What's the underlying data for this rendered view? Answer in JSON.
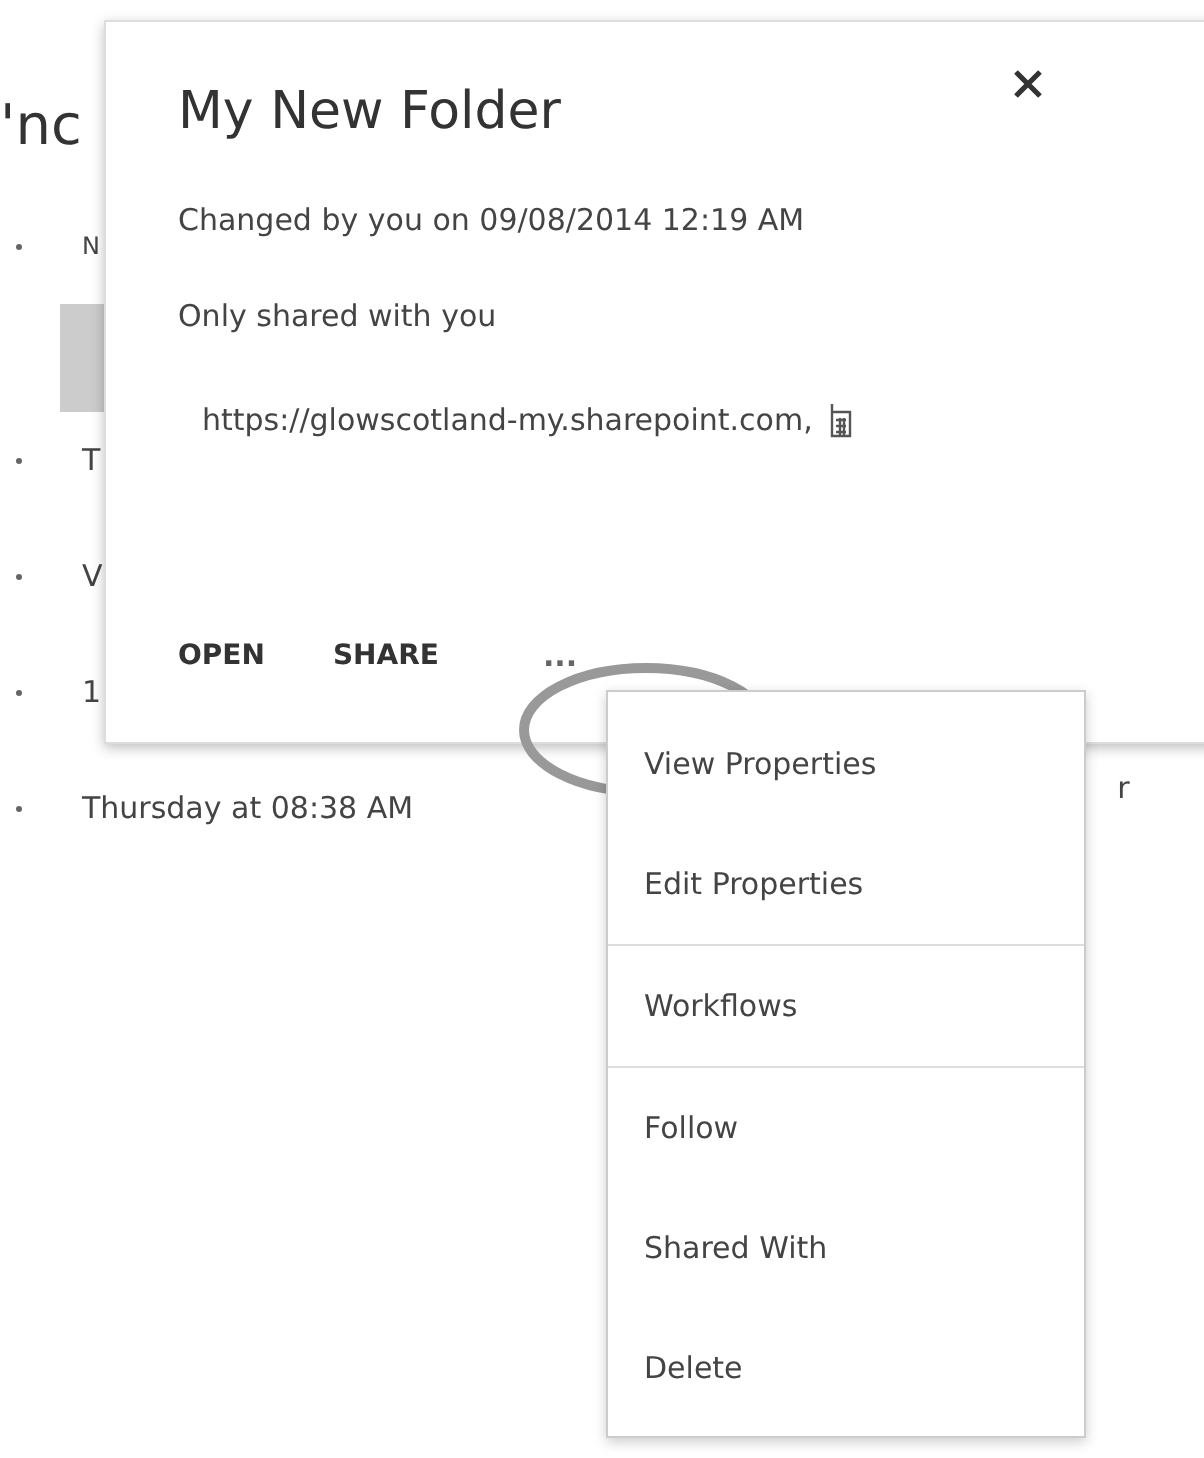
{
  "background": {
    "heading_fragment": "'nc",
    "rows": [
      {
        "text": "N"
      },
      {
        "text": "T"
      },
      {
        "text": "V"
      },
      {
        "text": "1"
      },
      {
        "text": "Thursday at 08:38 AM",
        "trailing": "r"
      }
    ]
  },
  "callout": {
    "title": "My New Folder",
    "changed": "Changed by you on 09/08/2014 12:19 AM",
    "sharing": "Only shared with you",
    "url": "https://glowscotland-my.sharepoint.com,",
    "actions": [
      "OPEN",
      "SHARE"
    ],
    "more": "..."
  },
  "menu": {
    "groups": [
      {
        "items": [
          "View Properties",
          "Edit Properties"
        ]
      },
      {
        "items": [
          "Workflows"
        ]
      },
      {
        "items": [
          "Follow",
          "Shared With",
          "Delete"
        ]
      }
    ]
  }
}
